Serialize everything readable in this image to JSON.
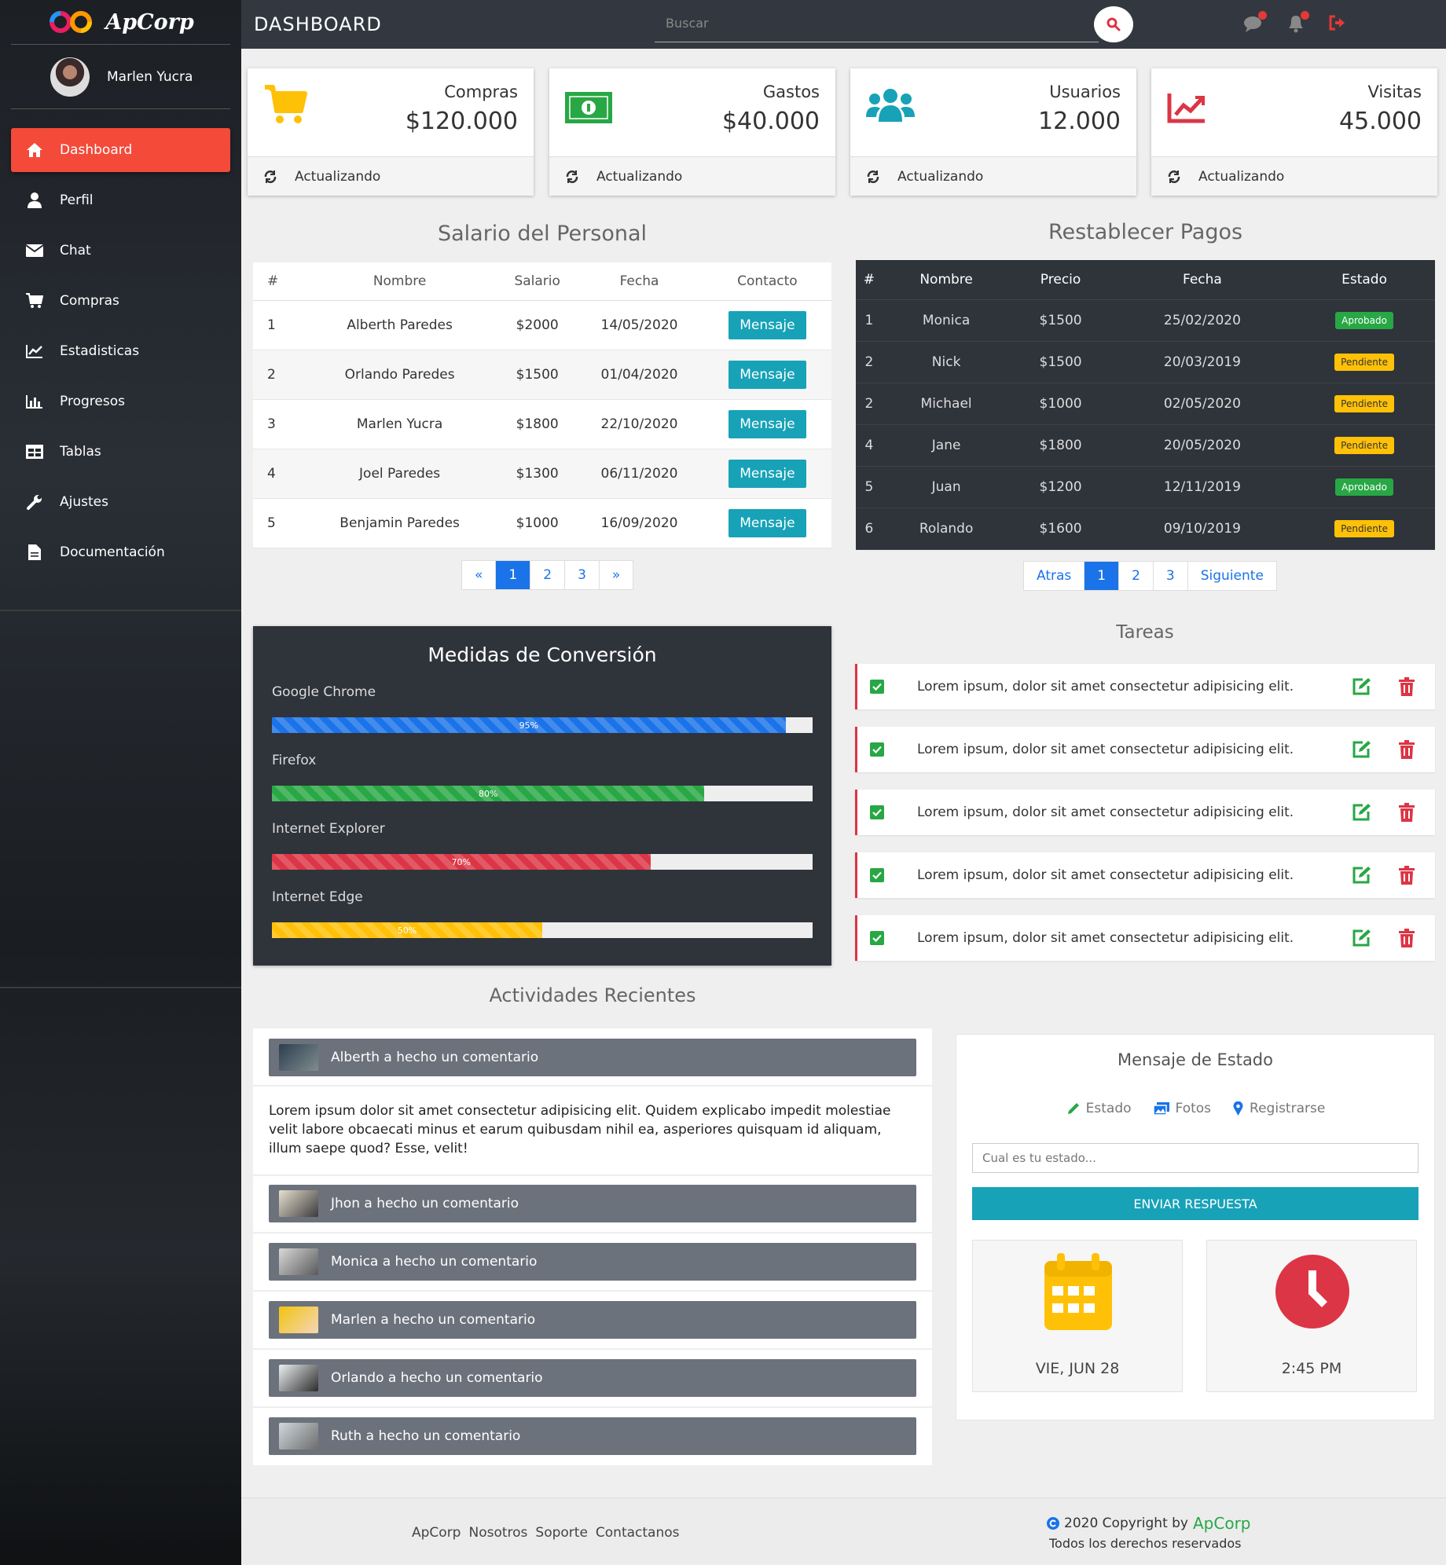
{
  "sidebar": {
    "brand": "ApCorp",
    "user": "Marlen Yucra",
    "items": [
      {
        "label": "Dashboard",
        "icon": "home-icon",
        "active": true
      },
      {
        "label": "Perfil",
        "icon": "user-icon"
      },
      {
        "label": "Chat",
        "icon": "envelope-icon"
      },
      {
        "label": "Compras",
        "icon": "cart-icon"
      },
      {
        "label": "Estadisticas",
        "icon": "line-chart-icon"
      },
      {
        "label": "Progresos",
        "icon": "bar-chart-icon"
      },
      {
        "label": "Tablas",
        "icon": "table-icon"
      },
      {
        "label": "Ajustes",
        "icon": "wrench-icon"
      },
      {
        "label": "Documentación",
        "icon": "document-icon"
      }
    ]
  },
  "header": {
    "title": "DASHBOARD",
    "search_placeholder": "Buscar"
  },
  "cards": [
    {
      "label": "Compras",
      "value": "$120.000",
      "status": "Actualizando",
      "color": "#ffc107"
    },
    {
      "label": "Gastos",
      "value": "$40.000",
      "status": "Actualizando",
      "color": "#28a745"
    },
    {
      "label": "Usuarios",
      "value": "12.000",
      "status": "Actualizando",
      "color": "#17a2b8"
    },
    {
      "label": "Visitas",
      "value": "45.000",
      "status": "Actualizando",
      "color": "#dc3545"
    }
  ],
  "salary": {
    "title": "Salario del Personal",
    "headers": [
      "#",
      "Nombre",
      "Salario",
      "Fecha",
      "Contacto"
    ],
    "button_label": "Mensaje",
    "rows": [
      [
        "1",
        "Alberth Paredes",
        "$2000",
        "14/05/2020"
      ],
      [
        "2",
        "Orlando Paredes",
        "$1500",
        "01/04/2020"
      ],
      [
        "3",
        "Marlen Yucra",
        "$1800",
        "22/10/2020"
      ],
      [
        "4",
        "Joel Paredes",
        "$1300",
        "06/11/2020"
      ],
      [
        "5",
        "Benjamin Paredes",
        "$1000",
        "16/09/2020"
      ]
    ],
    "pager": [
      "«",
      "1",
      "2",
      "3",
      "»"
    ]
  },
  "pagos": {
    "title": "Restablecer Pagos",
    "headers": [
      "#",
      "Nombre",
      "Precio",
      "Fecha",
      "Estado"
    ],
    "rows": [
      [
        "1",
        "Monica",
        "$1500",
        "25/02/2020",
        "Aprobado"
      ],
      [
        "2",
        "Nick",
        "$1500",
        "20/03/2019",
        "Pendiente"
      ],
      [
        "2",
        "Michael",
        "$1000",
        "02/05/2020",
        "Pendiente"
      ],
      [
        "4",
        "Jane",
        "$1800",
        "20/05/2020",
        "Pendiente"
      ],
      [
        "5",
        "Juan",
        "$1200",
        "12/11/2019",
        "Aprobado"
      ],
      [
        "6",
        "Rolando",
        "$1600",
        "09/10/2019",
        "Pendiente"
      ]
    ],
    "pager": [
      "Atras",
      "1",
      "2",
      "3",
      "Siguiente"
    ]
  },
  "conversion": {
    "title": "Medidas de Conversión",
    "items": [
      {
        "label": "Google Chrome",
        "percent": 95,
        "text": "95%",
        "color": "#1a73e8"
      },
      {
        "label": "Firefox",
        "percent": 80,
        "text": "80%",
        "color": "#28a745"
      },
      {
        "label": "Internet Explorer",
        "percent": 70,
        "text": "70%",
        "color": "#dc3545"
      },
      {
        "label": "Internet Edge",
        "percent": 50,
        "text": "50%",
        "color": "#ffc107"
      }
    ]
  },
  "tareas": {
    "title": "Tareas",
    "items": [
      "Lorem ipsum, dolor sit amet consectetur adipisicing elit.",
      "Lorem ipsum, dolor sit amet consectetur adipisicing elit.",
      "Lorem ipsum, dolor sit amet consectetur adipisicing elit.",
      "Lorem ipsum, dolor sit amet consectetur adipisicing elit.",
      "Lorem ipsum, dolor sit amet consectetur adipisicing elit."
    ]
  },
  "actividades": {
    "title": "Actividades Recientes",
    "first": "Alberth a hecho un comentario",
    "body": "Lorem ipsum dolor sit amet consectetur adipisicing elit. Quidem explicabo impedit molestiae velit labore obcaecati minus et earum quibusdam nihil ea, asperiores quisquam id aliquam, illum saepe quod? Esse, velit!",
    "items": [
      "Jhon a hecho un comentario",
      "Monica a hecho un comentario",
      "Marlen a hecho un comentario",
      "Orlando a hecho un comentario",
      "Ruth a hecho un comentario"
    ]
  },
  "estado": {
    "title": "Mensaje de Estado",
    "tabs": [
      "Estado",
      "Fotos",
      "Registrarse"
    ],
    "placeholder": "Cual es tu estado...",
    "button": "ENVIAR RESPUESTA",
    "date": "VIE, JUN 28",
    "time": "2:45 PM"
  },
  "footer": {
    "links": [
      "ApCorp",
      "Nosotros",
      "Soporte",
      "Contactanos"
    ],
    "copyright": "2020 Copyright by",
    "brand": "ApCorp",
    "rights": "Todos los derechos reservados"
  }
}
